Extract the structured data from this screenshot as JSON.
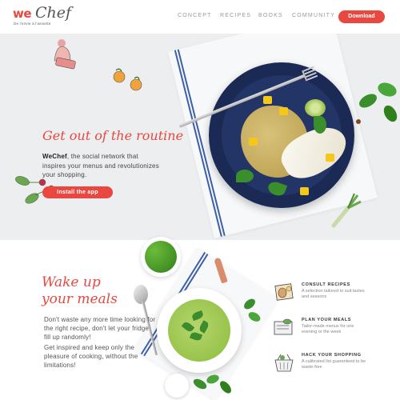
{
  "header": {
    "logo_we": "we",
    "logo_chef": "Chef",
    "logo_tagline": "De l'envie à l'assiette",
    "nav": [
      "CONCEPT",
      "RECIPES",
      "BOOKS",
      "COMMUNITY"
    ],
    "download_label": "Download"
  },
  "hero": {
    "title": "Get out of the routine",
    "brand": "WeChef",
    "text": ", the social network that inspires your menus and revolutionizes your shopping.",
    "install_label": "Install the app"
  },
  "wake": {
    "title_line1": "Wake up",
    "title_line2": "your meals",
    "paragraph1": "Don't waste any more time looking for the right recipe, don't let your fridge fill up randomly!",
    "paragraph2": "Get inspired and keep only the pleasure of cooking, without the limitations!"
  },
  "features": [
    {
      "title": "CONSULT RECIPES",
      "desc": "A selection tailored to suit tastes and seasons",
      "icon": "recipe-book-icon"
    },
    {
      "title": "PLAN YOUR MEALS",
      "desc": "Tailor-made menus for one evening or the week",
      "icon": "planner-icon"
    },
    {
      "title": "HACK YOUR SHOPPING",
      "desc": "A calibrated list guaranteed to be waste-free",
      "icon": "shopping-basket-icon"
    }
  ],
  "colors": {
    "accent": "#e8483f",
    "hero_bg": "#eceef0",
    "plate": "#1b2a55"
  }
}
